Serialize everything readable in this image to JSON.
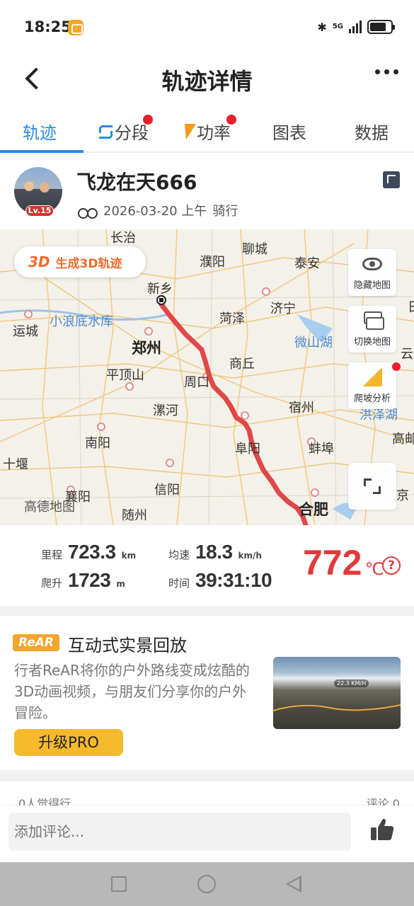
{
  "status_bar": {
    "time": "18:25",
    "network": "5G",
    "bluetooth_icon": "bluetooth-icon",
    "battery_icon": "battery-icon"
  },
  "nav": {
    "title": "轨迹详情",
    "back_icon": "back-arrow-icon",
    "more_icon": "more-dots-icon"
  },
  "tabs": [
    {
      "label": "轨迹",
      "active": true,
      "dot": false
    },
    {
      "label": "分段",
      "active": false,
      "dot": true,
      "icon": "segment-icon"
    },
    {
      "label": "功率",
      "active": false,
      "dot": true,
      "icon": "lightning-icon"
    },
    {
      "label": "图表",
      "active": false,
      "dot": false
    },
    {
      "label": "数据",
      "active": false,
      "dot": false
    }
  ],
  "profile": {
    "username": "飞龙在天666",
    "level": "Lv.15",
    "date": "2026-03-20 上午",
    "activity": "骑行"
  },
  "map": {
    "button_3d_badge": "3D",
    "button_3d_label": "生成3D轨迹",
    "side_buttons": [
      {
        "label": "隐藏地图",
        "icon": "eye-icon"
      },
      {
        "label": "切换地图",
        "icon": "layers-icon"
      },
      {
        "label": "爬坡分析",
        "icon": "slope-icon"
      }
    ],
    "logo": "高德地图",
    "cities": {
      "changzhi": "长治",
      "puyang": "濮阳",
      "liaocheng": "聊城",
      "taian": "泰安",
      "xinxiang": "新乡",
      "yuncheng": "运城",
      "xiaolangdi": "小浪底水库",
      "heze": "菏泽",
      "jining": "济宁",
      "zhengzhou": "郑州",
      "weishan": "微山湖",
      "pingdingshan": "平顶山",
      "zhoukou": "周口",
      "shangqiu": "商丘",
      "luohe": "漯河",
      "suzhou": "宿州",
      "nanyang": "南阳",
      "fuyang": "阜阳",
      "bengbu": "蚌埠",
      "shiyan": "十堰",
      "xiangyang": "襄阳",
      "xinyang": "信阳",
      "suizhou": "随州",
      "hefei": "合肥",
      "hongze": "洪泽湖",
      "gaoyou": "高邮",
      "yun": "云",
      "ri": "日",
      "jing": "京"
    }
  },
  "stats": {
    "distance": {
      "label": "里程",
      "value": "723.3",
      "unit": "km"
    },
    "avg_speed": {
      "label": "均速",
      "value": "18.3",
      "unit": "km/h"
    },
    "climb": {
      "label": "爬升",
      "value": "1723",
      "unit": "m"
    },
    "time": {
      "label": "时间",
      "value": "39:31:10"
    },
    "temperature": {
      "value": "772",
      "unit": "℃",
      "help": "?"
    }
  },
  "promo": {
    "badge": "ReAR",
    "title": "互动式实景回放",
    "description": "行者ReAR将你的户外路线变成炫酷的3D动画视频，与朋友们分享你的户外冒险。",
    "button": "升级PRO",
    "thumb_speed": "22.3 KM/H"
  },
  "footer": {
    "likes": "0人觉得行",
    "comments": "评论 0",
    "comment_placeholder": "添加评论...",
    "like_icon": "thumbs-up-icon"
  },
  "colors": {
    "accent": "#2a8be6",
    "track": "#e04848",
    "temperature": "#e13a3a",
    "promo": "#f4a52c"
  }
}
